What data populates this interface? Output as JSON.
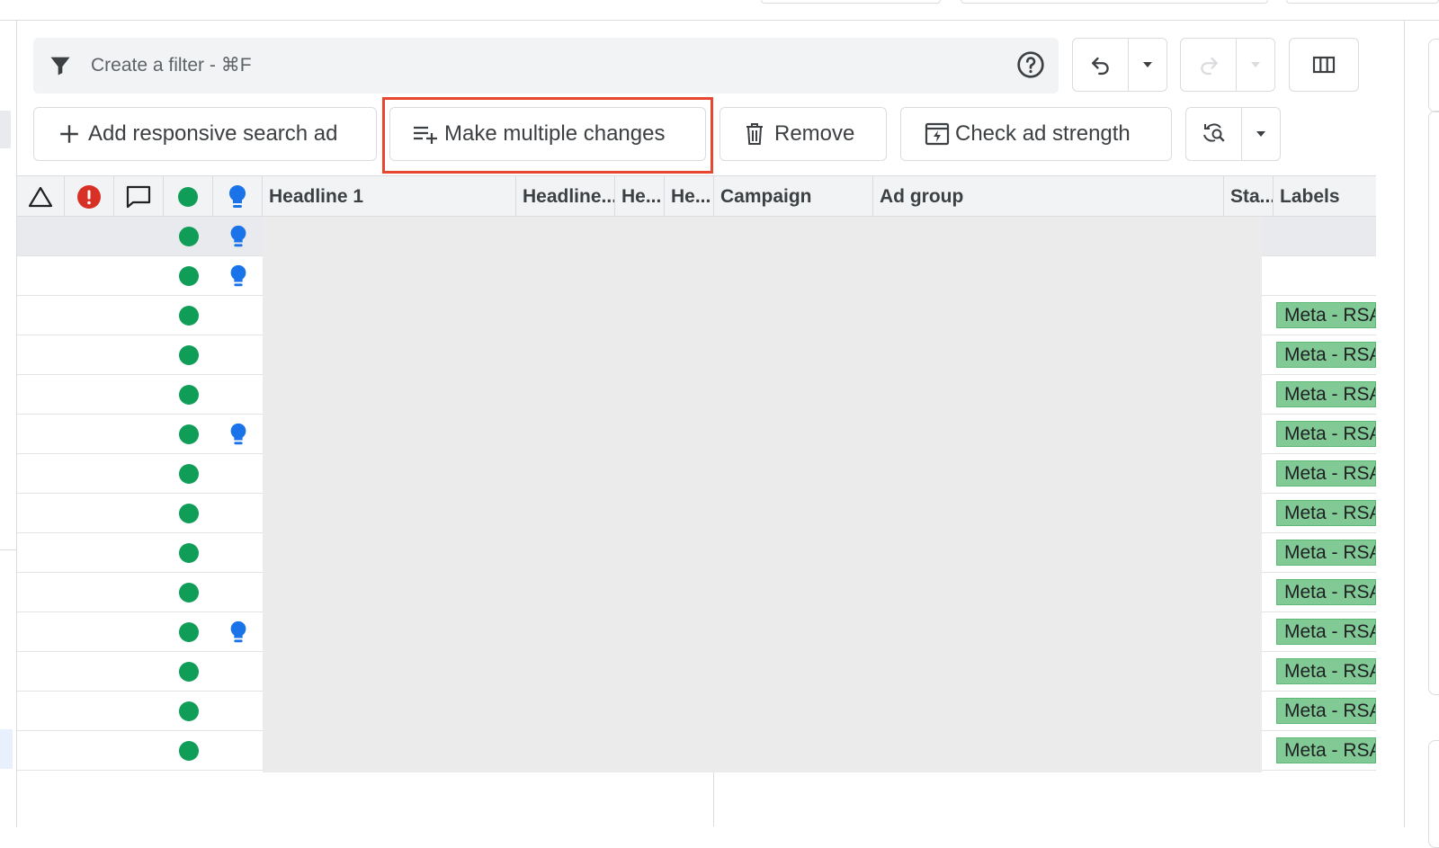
{
  "filter": {
    "placeholder": "Create a filter - ⌘F",
    "filter_icon": "filter-icon",
    "help_icon": "help-icon"
  },
  "toolbar": {
    "undo_icon": "undo-icon",
    "redo_icon": "redo-icon",
    "columns_icon": "columns-icon",
    "add_rsa_label": "Add responsive search ad",
    "make_changes_label": "Make multiple changes",
    "remove_label": "Remove",
    "check_strength_label": "Check ad strength",
    "refresh_icon": "refresh-search-icon"
  },
  "table": {
    "columns": {
      "warning": "warning-icon",
      "error": "error-icon",
      "comment": "comment-icon",
      "status": "status-dot-icon",
      "recommendation": "lightbulb-icon",
      "headline1": "Headline 1",
      "headline2": "Headline...",
      "headline3": "He...",
      "headline4": "He...",
      "campaign": "Campaign",
      "ad_group": "Ad group",
      "status_col": "Sta...",
      "labels": "Labels"
    },
    "rows": [
      {
        "bulb": true,
        "label": ""
      },
      {
        "bulb": true,
        "label": ""
      },
      {
        "bulb": false,
        "label": "Meta - RSA"
      },
      {
        "bulb": false,
        "label": "Meta - RSA"
      },
      {
        "bulb": false,
        "label": "Meta - RSA"
      },
      {
        "bulb": true,
        "label": "Meta - RSA"
      },
      {
        "bulb": false,
        "label": "Meta - RSA"
      },
      {
        "bulb": false,
        "label": "Meta - RSA"
      },
      {
        "bulb": false,
        "label": "Meta - RSA"
      },
      {
        "bulb": false,
        "label": "Meta - RSA"
      },
      {
        "bulb": true,
        "label": "Meta - RSA"
      },
      {
        "bulb": false,
        "label": "Meta - RSA"
      },
      {
        "bulb": false,
        "label": "Meta - RSA"
      },
      {
        "bulb": false,
        "label": "Meta - RSA"
      }
    ]
  },
  "colors": {
    "status_green": "#0f9d58",
    "bulb_blue": "#1a73e8",
    "label_green": "#81c995",
    "highlight_red": "#e8472f",
    "error_red": "#d93025"
  }
}
